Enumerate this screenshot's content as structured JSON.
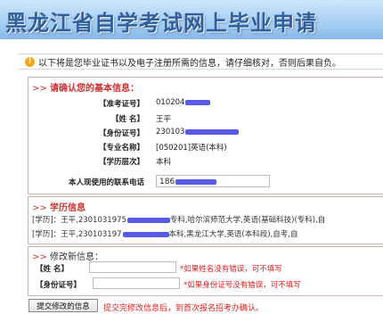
{
  "banner": {
    "title": "黑龙江省自学考试网上毕业申请"
  },
  "notice": {
    "text": "以下将是您毕业证书以及电子注册所需的信息，请仔细核对，否则后果自负。"
  },
  "basic_info": {
    "title": "请确认您的基本信息：",
    "fields": [
      {
        "label": "【准考证号】",
        "value": "010204"
      },
      {
        "label": "【姓  名】",
        "value": "王平"
      },
      {
        "label": "【身份证号】",
        "value": "230103"
      },
      {
        "label": "【专业名称】",
        "value": "[050201]英语(本科)"
      },
      {
        "label": "【学历层次】",
        "value": "本科"
      }
    ],
    "phone_label": "本人现使用的联系电话",
    "phone_value": "186"
  },
  "education": {
    "title": "学历信息",
    "records": [
      {
        "prefix": "[学历]：王平,2301031975",
        "suffix": "专科,哈尔滨师范大学,英语(基础科技)(专科),自"
      },
      {
        "prefix": "[学历]：王平,230103197",
        "suffix": "本科,黑龙江大学,英语(本科段),自考,自"
      }
    ]
  },
  "modify": {
    "title": "修改新信息：",
    "name_label": "【姓 名】",
    "name_hint": "*如果姓名没有错误，可不填写",
    "id_label": "【身份证号】",
    "id_hint": "*如果身份证号没有错误，可不填写"
  },
  "submit": {
    "button_label": "提交修改的信息",
    "after_text": "提交完修改信息后，到首次报名招考办确认。"
  },
  "colors": {
    "accent_red": "#c83232",
    "banner_blue": "#2f5f9c",
    "mask_blue": "#3b3ee0"
  }
}
